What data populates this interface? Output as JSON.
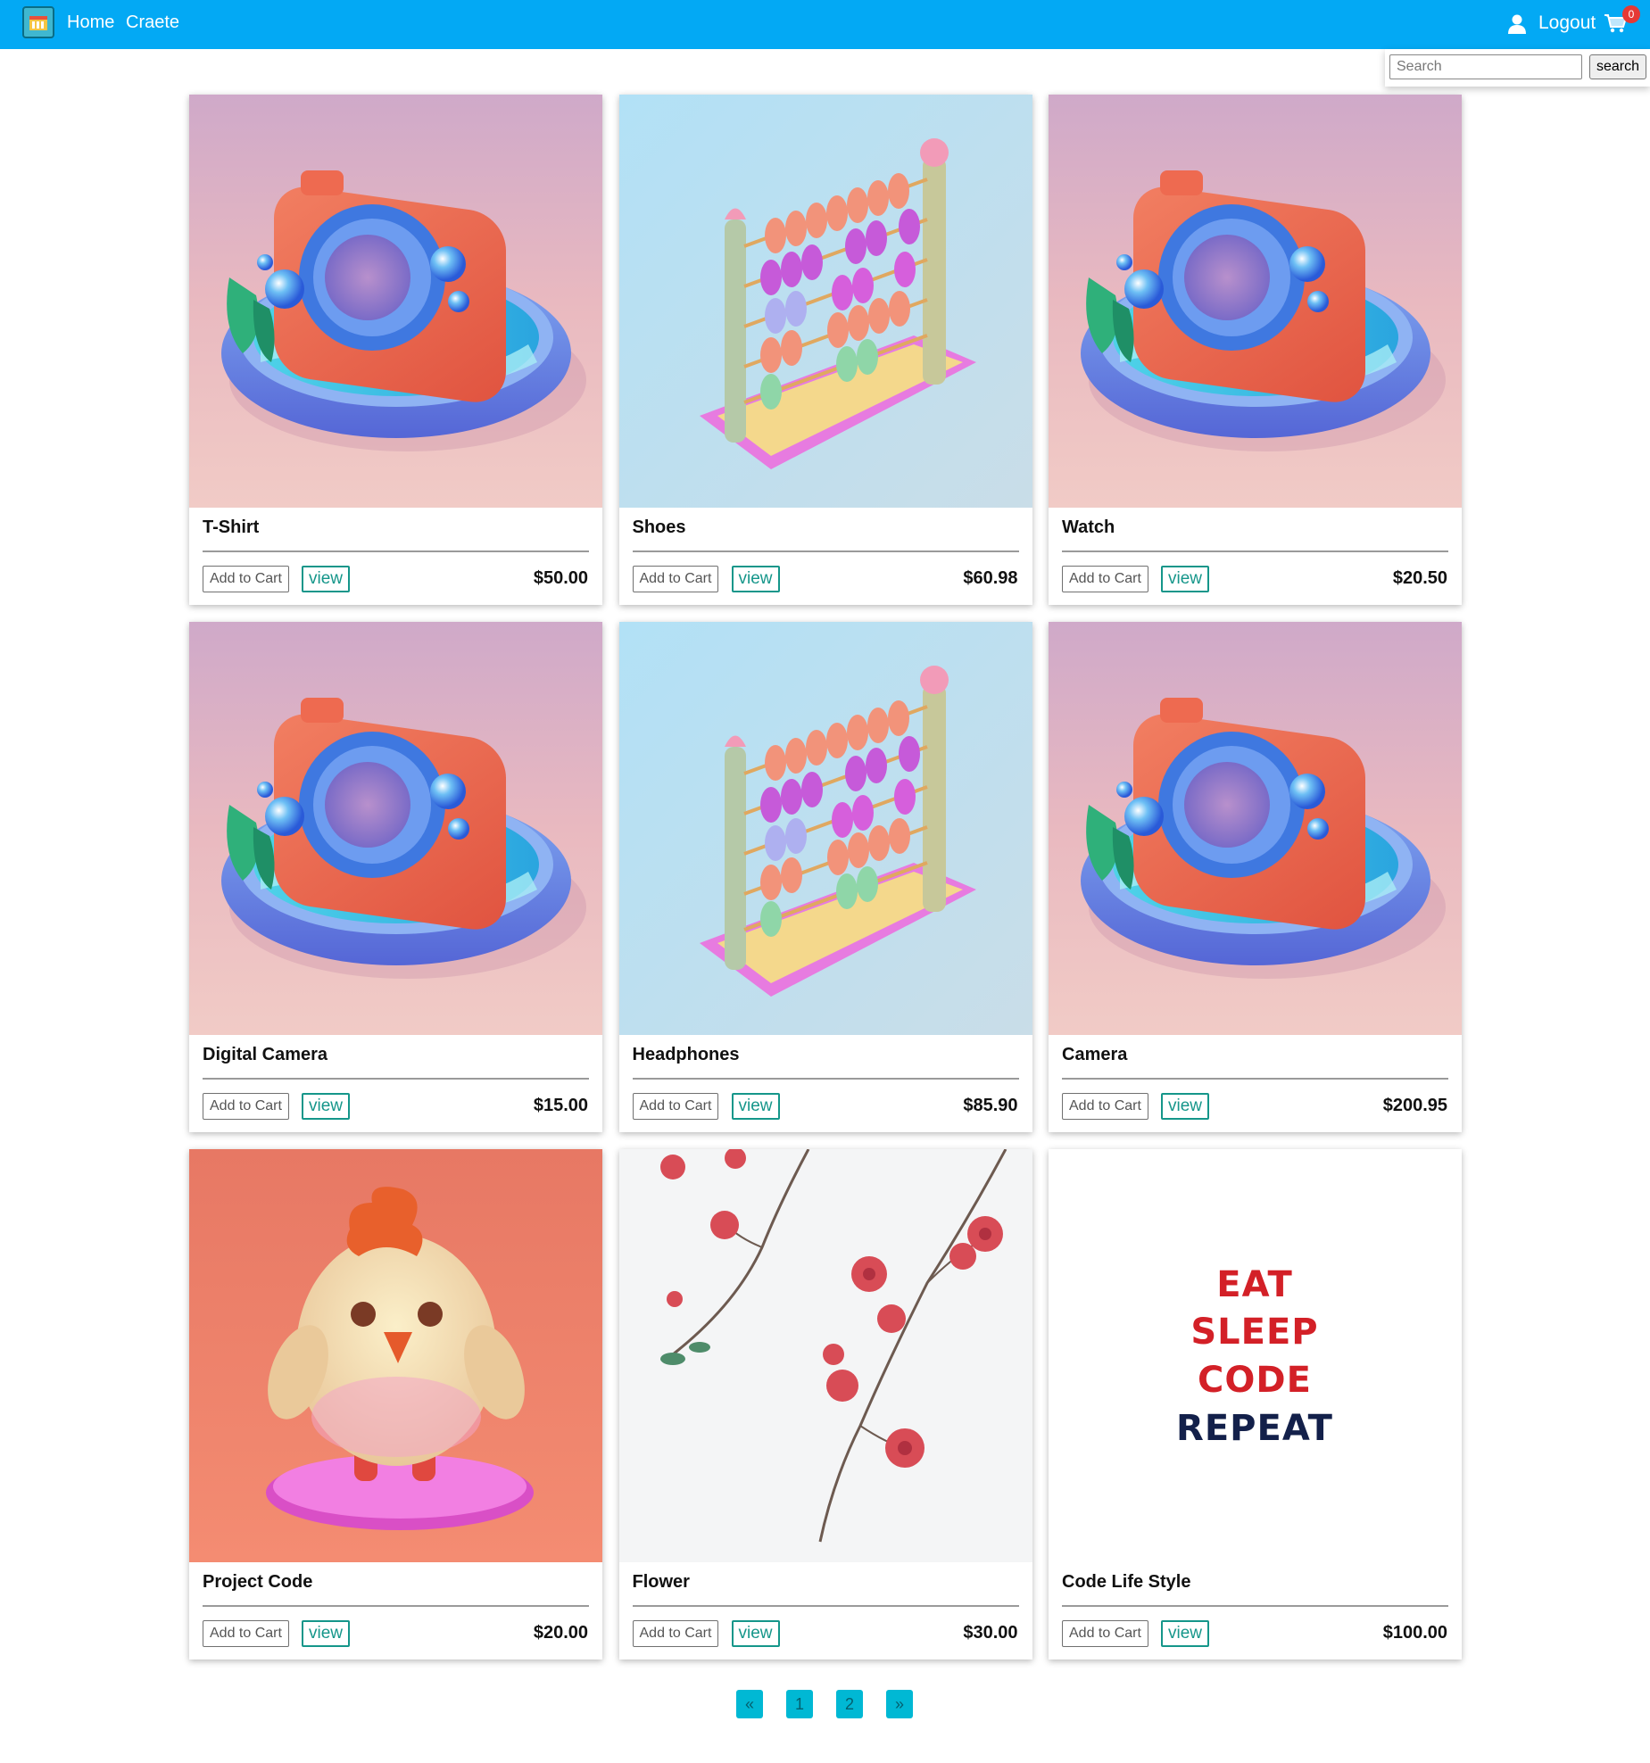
{
  "nav": {
    "home": "Home",
    "create": "Craete",
    "logout": "Logout",
    "cart_count": "0"
  },
  "search": {
    "placeholder": "Search",
    "button": "search"
  },
  "products": [
    {
      "title": "T-Shirt",
      "price": "$50.00",
      "image": "camera-art",
      "add_label": "Add to Cart",
      "view_label": "view"
    },
    {
      "title": "Shoes",
      "price": "$60.98",
      "image": "abacus-art",
      "add_label": "Add to Cart",
      "view_label": "view"
    },
    {
      "title": "Watch",
      "price": "$20.50",
      "image": "camera-art",
      "add_label": "Add to Cart",
      "view_label": "view"
    },
    {
      "title": "Digital Camera",
      "price": "$15.00",
      "image": "camera-art",
      "add_label": "Add to Cart",
      "view_label": "view"
    },
    {
      "title": "Headphones",
      "price": "$85.90",
      "image": "abacus-art",
      "add_label": "Add to Cart",
      "view_label": "view"
    },
    {
      "title": "Camera",
      "price": "$200.95",
      "image": "camera-art",
      "add_label": "Add to Cart",
      "view_label": "view"
    },
    {
      "title": "Project Code",
      "price": "$20.00",
      "image": "chick-art",
      "add_label": "Add to Cart",
      "view_label": "view"
    },
    {
      "title": "Flower",
      "price": "$30.00",
      "image": "blossom-art",
      "add_label": "Add to Cart",
      "view_label": "view"
    },
    {
      "title": "Code Life Style",
      "price": "$100.00",
      "image": "text-art",
      "add_label": "Add to Cart",
      "view_label": "view",
      "image_text": [
        "EAT",
        "SLEEP",
        "CODE",
        "REPEAT"
      ]
    }
  ],
  "pagination": {
    "prev": "«",
    "pages": [
      "1",
      "2"
    ],
    "next": "»"
  },
  "colors": {
    "navbar": "#03a9f4",
    "view_button": "#15968a",
    "pager_button": "#00b8d4",
    "badge": "#e53935"
  }
}
